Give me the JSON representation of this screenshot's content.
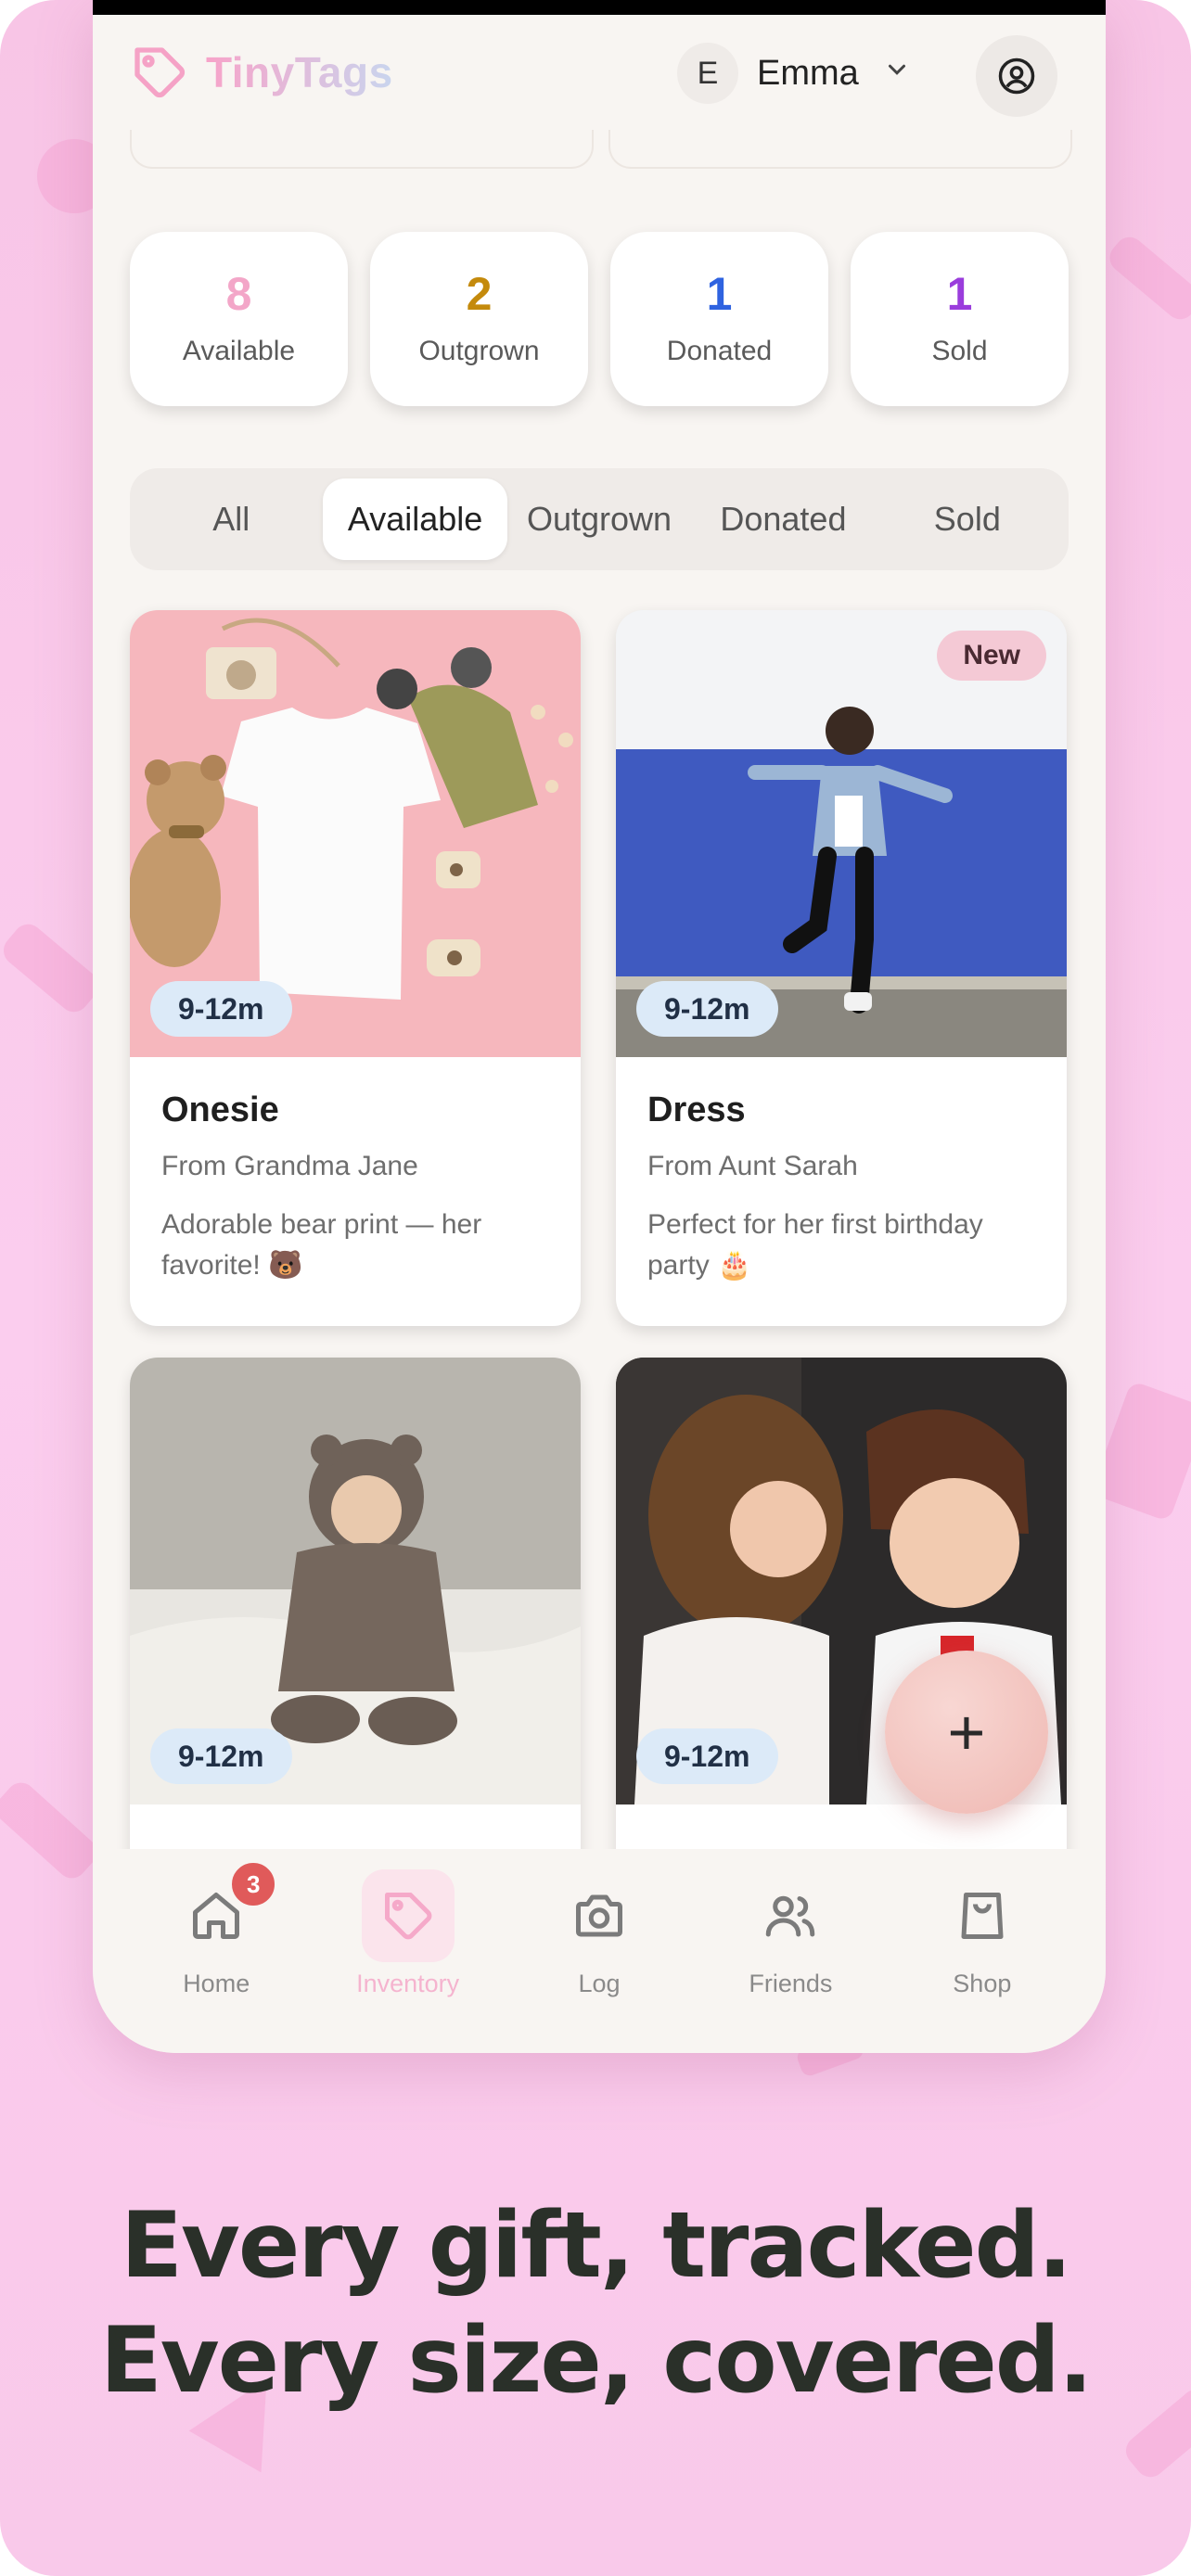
{
  "app": {
    "name": "TinyTags"
  },
  "user": {
    "initial": "E",
    "name": "Emma"
  },
  "stats": [
    {
      "value": "8",
      "label": "Available",
      "color": "#f3a6c8"
    },
    {
      "value": "2",
      "label": "Outgrown",
      "color": "#c48a0c"
    },
    {
      "value": "1",
      "label": "Donated",
      "color": "#2f63e0"
    },
    {
      "value": "1",
      "label": "Sold",
      "color": "#9a3ddc"
    }
  ],
  "filters": {
    "tabs": [
      "All",
      "Available",
      "Outgrown",
      "Donated",
      "Sold"
    ],
    "active": "Available"
  },
  "items": [
    {
      "title": "Onesie",
      "from": "From Grandma Jane",
      "note": "Adorable bear print — her favorite! 🐻",
      "size": "9-12m",
      "is_new": false
    },
    {
      "title": "Dress",
      "from": "From Aunt Sarah",
      "note": "Perfect for her first birthday party 🎂",
      "size": "9-12m",
      "badge": "New",
      "is_new": true
    },
    {
      "title": "",
      "from": "",
      "note": "",
      "size": "9-12m",
      "is_new": false
    },
    {
      "title": "",
      "from": "",
      "note": "",
      "size": "9-12m",
      "is_new": false
    }
  ],
  "fab": {
    "label": "+"
  },
  "nav": {
    "items": [
      {
        "label": "Home",
        "icon": "home-icon",
        "badge": "3"
      },
      {
        "label": "Inventory",
        "icon": "tag-icon",
        "active": true
      },
      {
        "label": "Log",
        "icon": "camera-icon"
      },
      {
        "label": "Friends",
        "icon": "users-icon"
      },
      {
        "label": "Shop",
        "icon": "shopping-bag-icon"
      }
    ]
  },
  "tagline": {
    "line1": "Every gift, tracked.",
    "line2": "Every size, covered."
  },
  "colors": {
    "brand_pink": "#f7a3c9",
    "background": "#fbcdee",
    "surface": "#f8f5f2"
  }
}
